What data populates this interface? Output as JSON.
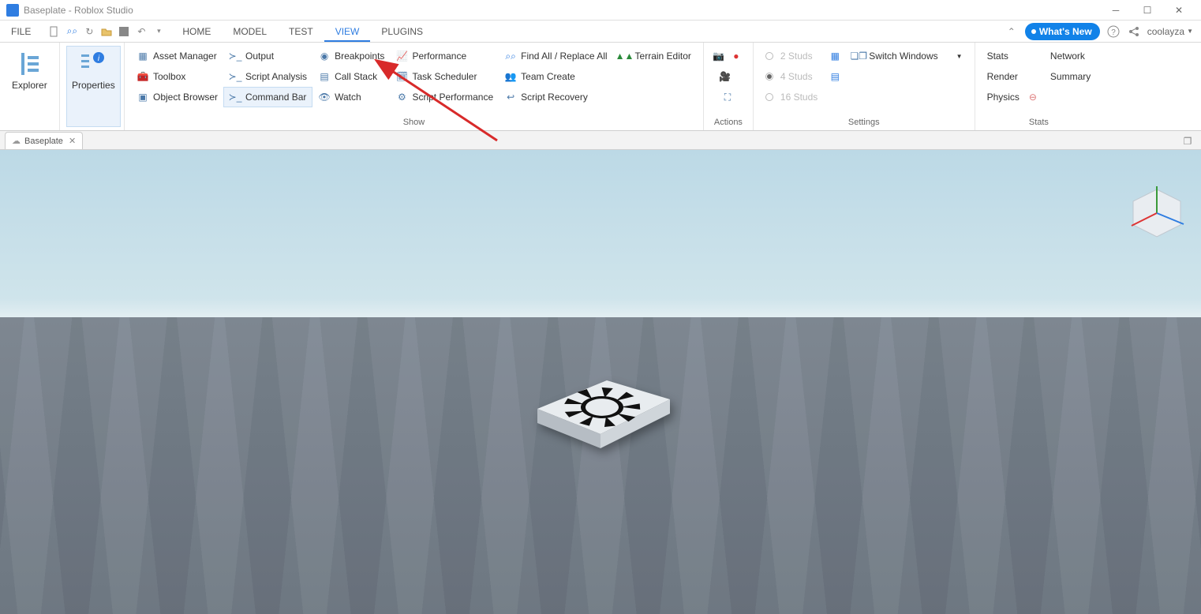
{
  "window": {
    "title": "Baseplate - Roblox Studio",
    "user": "coolayza",
    "whatsnew": "What's New"
  },
  "tabs": {
    "file": "FILE",
    "home": "HOME",
    "model": "MODEL",
    "test": "TEST",
    "view": "VIEW",
    "plugins": "PLUGINS"
  },
  "ribbon": {
    "explorer": "Explorer",
    "properties": "Properties",
    "asset_manager": "Asset Manager",
    "toolbox": "Toolbox",
    "object_browser": "Object Browser",
    "output": "Output",
    "script_analysis": "Script Analysis",
    "command_bar": "Command Bar",
    "breakpoints": "Breakpoints",
    "call_stack": "Call Stack",
    "watch": "Watch",
    "performance": "Performance",
    "task_scheduler": "Task Scheduler",
    "script_performance": "Script Performance",
    "find_all": "Find All / Replace All",
    "team_create": "Team Create",
    "script_recovery": "Script Recovery",
    "terrain_editor": "Terrain Editor",
    "show_label": "Show",
    "actions_label": "Actions",
    "studs2": "2 Studs",
    "studs4": "4 Studs",
    "studs16": "16 Studs",
    "switch_windows": "Switch Windows",
    "settings_label": "Settings",
    "stats": "Stats",
    "render": "Render",
    "physics": "Physics",
    "network": "Network",
    "summary": "Summary",
    "stats_label": "Stats"
  },
  "doc": {
    "tab": "Baseplate"
  }
}
